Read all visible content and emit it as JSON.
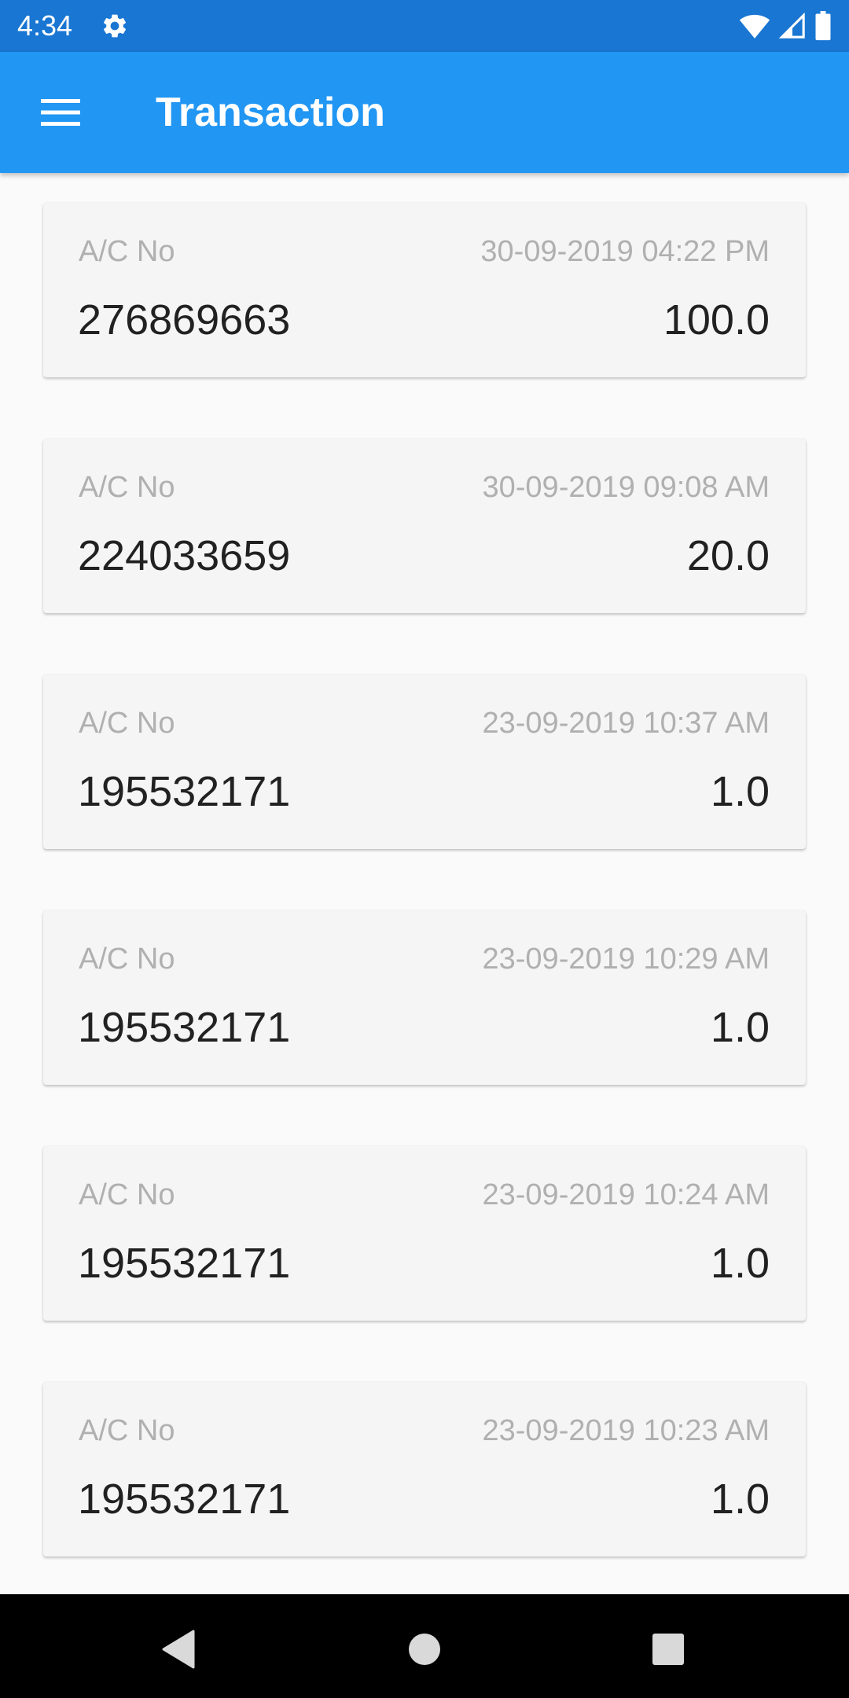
{
  "status_bar": {
    "time": "4:34",
    "icons": [
      "settings-gear-icon",
      "wifi-icon",
      "cell-signal-icon",
      "battery-icon"
    ]
  },
  "app_bar": {
    "title": "Transaction",
    "menu_icon": "hamburger-menu-icon"
  },
  "transactions": [
    {
      "label": "A/C No",
      "date": "30-09-2019 04:22 PM",
      "account": "276869663",
      "amount": "100.0"
    },
    {
      "label": "A/C No",
      "date": "30-09-2019 09:08 AM",
      "account": "224033659",
      "amount": "20.0"
    },
    {
      "label": "A/C No",
      "date": "23-09-2019 10:37 AM",
      "account": "195532171",
      "amount": "1.0"
    },
    {
      "label": "A/C No",
      "date": "23-09-2019 10:29 AM",
      "account": "195532171",
      "amount": "1.0"
    },
    {
      "label": "A/C No",
      "date": "23-09-2019 10:24 AM",
      "account": "195532171",
      "amount": "1.0"
    },
    {
      "label": "A/C No",
      "date": "23-09-2019 10:23 AM",
      "account": "195532171",
      "amount": "1.0"
    }
  ],
  "nav_bar": {
    "icons": [
      "back-icon",
      "home-icon",
      "recents-icon"
    ]
  },
  "colors": {
    "status_bar": "#1976d2",
    "app_bar": "#2196f3",
    "card_background": "#f5f5f5",
    "label_text": "#b0b0b0",
    "value_text": "#212121"
  }
}
